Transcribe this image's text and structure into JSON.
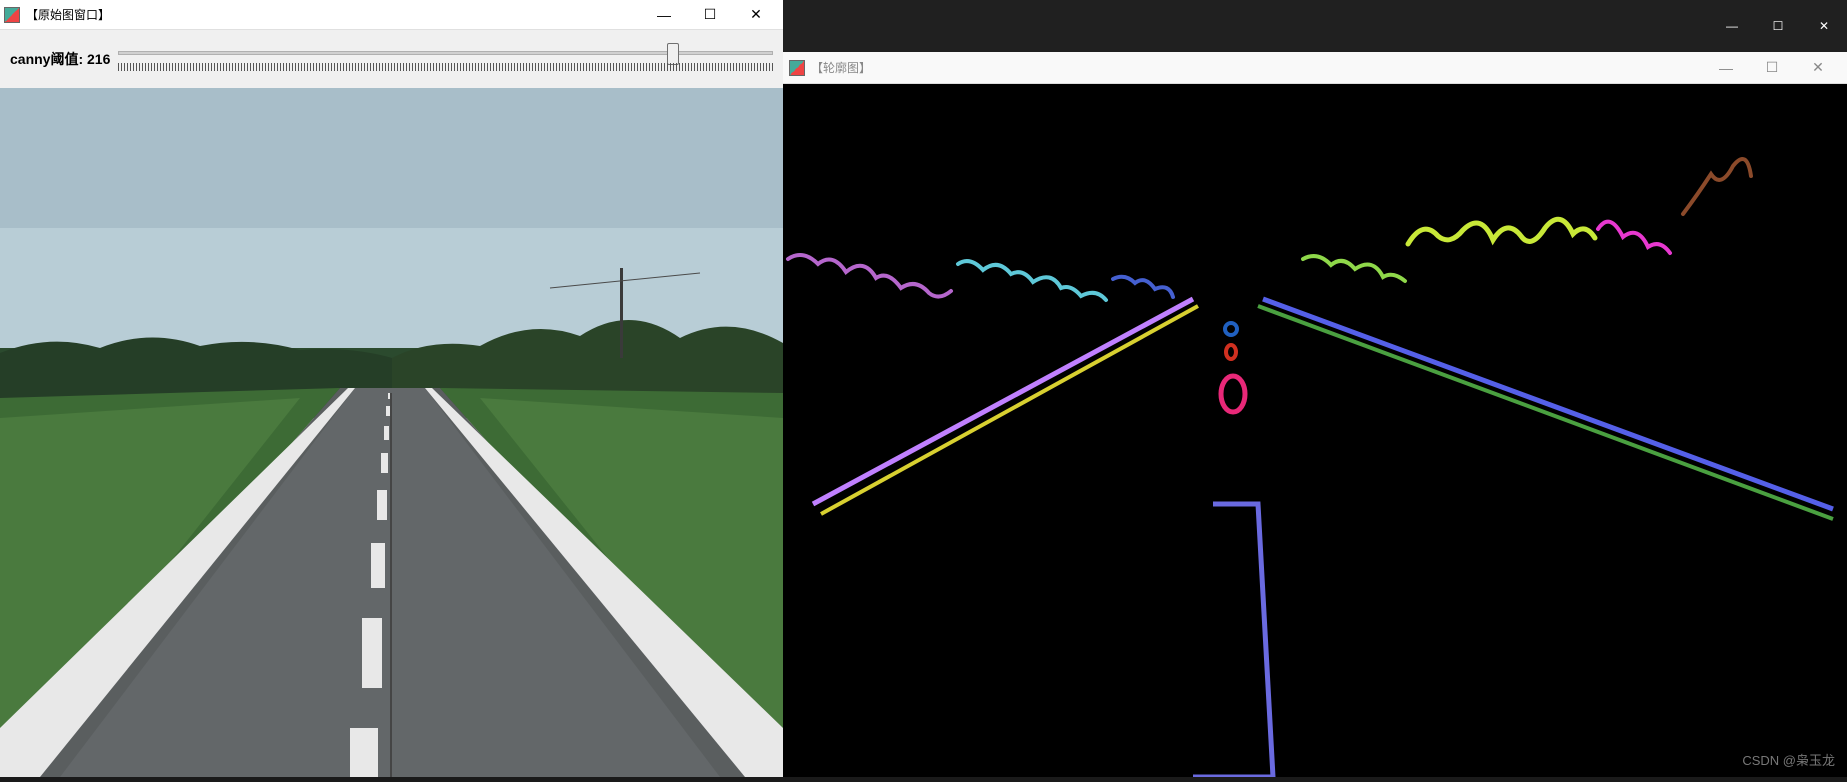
{
  "leftWindow": {
    "title": "【原始图窗口】",
    "trackbar": {
      "label": "canny阈值:",
      "value": "216",
      "max": 255,
      "position_pct": 84.7
    }
  },
  "rightWindow": {
    "title": "【轮廓图】"
  },
  "watermark": "CSDN @枭玉龙",
  "icons": {
    "minimize": "—",
    "maximize": "☐",
    "close": "✕"
  }
}
